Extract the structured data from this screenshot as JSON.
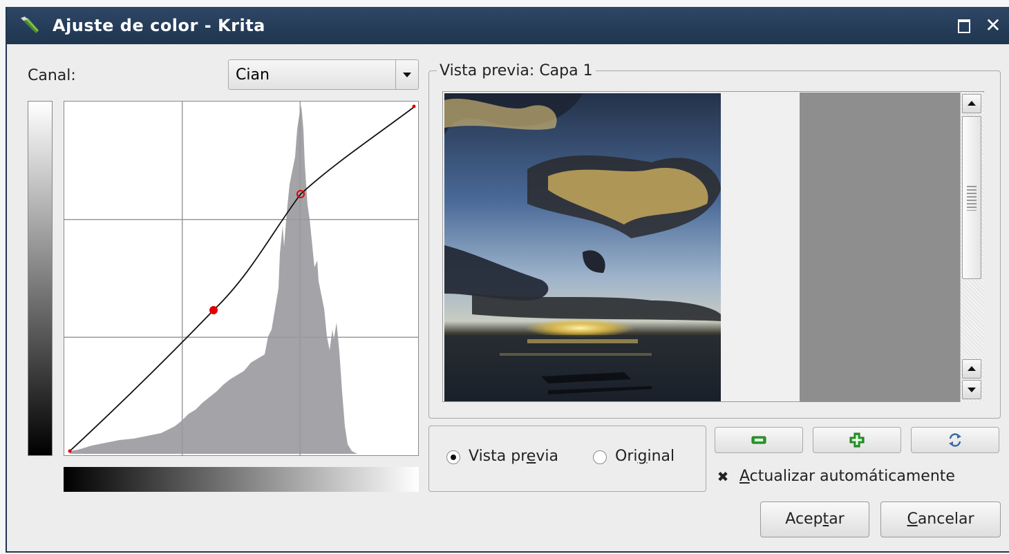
{
  "window": {
    "title": "Ajuste de color - Krita",
    "close_glyph": "✕"
  },
  "channel": {
    "label": "Canal:",
    "selected": "Cian"
  },
  "preview": {
    "group_title": "Vista previa: Capa 1"
  },
  "view_mode": {
    "options": [
      {
        "label_pre": "Vista pr",
        "label_key": "e",
        "label_post": "via",
        "checked": true
      },
      {
        "label_pre": "Ori",
        "label_key": "g",
        "label_post": "inal",
        "checked": false
      }
    ]
  },
  "toolbar": {
    "zoom_out_icon": "minus-icon",
    "zoom_in_icon": "plus-icon",
    "refresh_icon": "refresh-icon",
    "icon_color": "#2a9d2a"
  },
  "auto_update": {
    "checked": true,
    "glyph": "✖",
    "label_key": "A",
    "label_post": "ctualizar automáticamente"
  },
  "buttons": {
    "ok_pre": "Acep",
    "ok_key": "t",
    "ok_post": "ar",
    "cancel_key": "C",
    "cancel_post": "ancelar"
  }
}
